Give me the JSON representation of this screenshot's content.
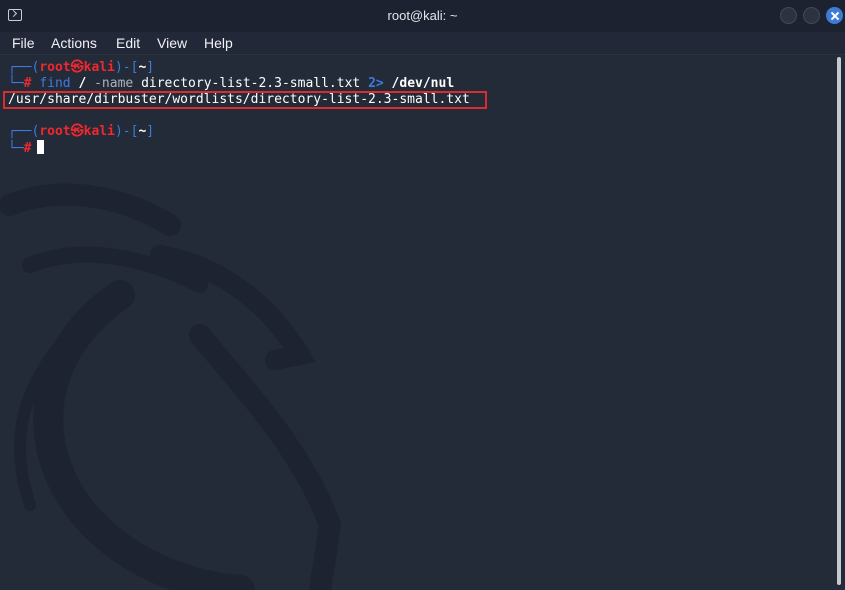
{
  "window": {
    "title": "root@kali: ~",
    "buttons": [
      "minimize-button",
      "maximize-button",
      "close-button"
    ]
  },
  "menu": {
    "items": [
      "File",
      "Actions",
      "Edit",
      "View",
      "Help"
    ]
  },
  "terminal": {
    "prompt1": {
      "frame_top_left": "┌──(",
      "user": "root",
      "at": "㉿",
      "host": "kali",
      "frame_mid": ")-[",
      "path": "~",
      "frame_end": "]",
      "frame_bottom_left": "└─",
      "hash": "#",
      "cmd": "find",
      "arg_root": "/",
      "flag": "-name",
      "pattern": "directory-list-2.3-small.txt",
      "redirect": "2>",
      "devnull": "/dev/nul"
    },
    "output": "/usr/share/dirbuster/wordlists/directory-list-2.3-small.txt",
    "prompt2": {
      "frame_top_left": "┌──(",
      "user": "root",
      "at": "㉿",
      "host": "kali",
      "frame_mid": ")-[",
      "path": "~",
      "frame_end": "]",
      "frame_bottom_left": "└─",
      "hash": "#"
    }
  },
  "colors": {
    "background": "#232a38",
    "prompt_frame": "#3d7be0",
    "prompt_user": "#f0282f",
    "highlight_border": "#d92d2d",
    "close_button": "#3e7bd6"
  }
}
